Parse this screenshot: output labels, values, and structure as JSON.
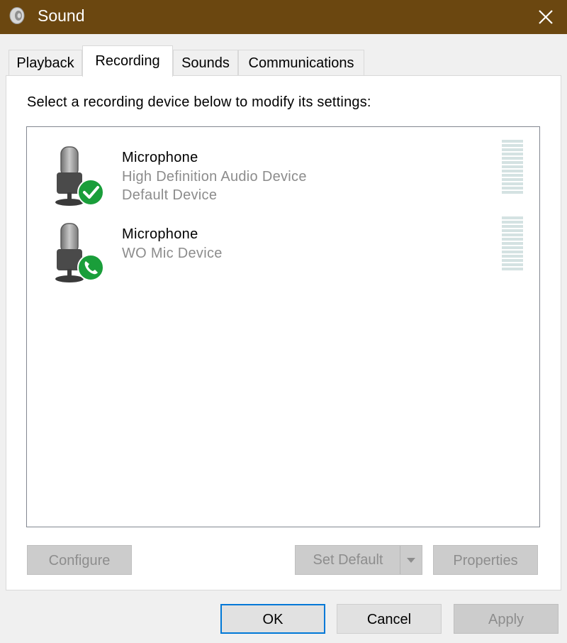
{
  "window": {
    "title": "Sound",
    "titlebar_color": "#6b4710"
  },
  "tabs": [
    {
      "label": "Playback",
      "active": false
    },
    {
      "label": "Recording",
      "active": true
    },
    {
      "label": "Sounds",
      "active": false
    },
    {
      "label": "Communications",
      "active": false
    }
  ],
  "instruction": "Select a recording device below to modify its settings:",
  "devices": [
    {
      "name": "Microphone",
      "description": "High Definition Audio Device",
      "status": "Default Device",
      "badge_icon": "check-badge-icon",
      "level": 0
    },
    {
      "name": "Microphone",
      "description": "WO Mic Device",
      "status": "",
      "badge_icon": "phone-badge-icon",
      "level": 0
    }
  ],
  "panel_buttons": {
    "configure": "Configure",
    "set_default": "Set Default",
    "properties": "Properties"
  },
  "dialog_buttons": {
    "ok": "OK",
    "cancel": "Cancel",
    "apply": "Apply"
  },
  "colors": {
    "badge_green": "#1a9e3a",
    "focus_blue": "#0078d7"
  }
}
